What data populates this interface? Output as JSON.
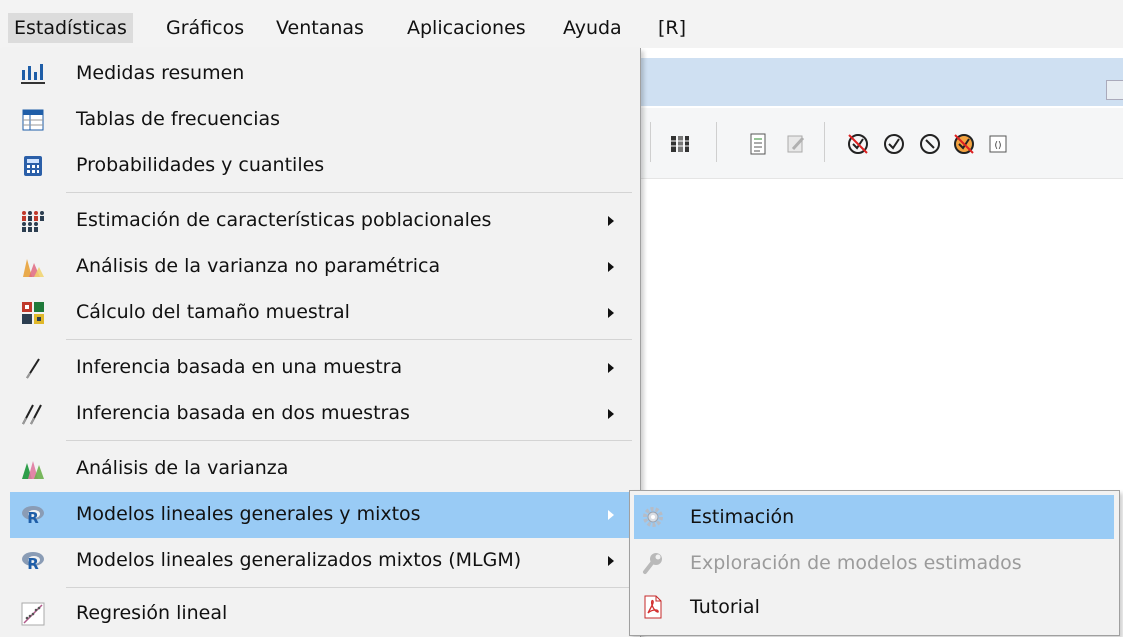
{
  "menubar": {
    "items": [
      "Estadísticas",
      "Gráficos",
      "Ventanas",
      "Aplicaciones",
      "Ayuda",
      "[R]"
    ],
    "active": "Estadísticas"
  },
  "menu": {
    "items": [
      {
        "label": "Medidas resumen",
        "icon": "summary-measures-icon"
      },
      {
        "label": "Tablas de frecuencias",
        "icon": "frequency-table-icon"
      },
      {
        "label": "Probabilidades y cuantiles",
        "icon": "calculator-icon"
      },
      {
        "label": "Estimación de características poblacionales",
        "icon": "population-icon",
        "submenu": true
      },
      {
        "label": "Análisis de la varianza no paramétrica",
        "icon": "nonparametric-anova-icon",
        "submenu": true
      },
      {
        "label": "Cálculo del tamaño muestral",
        "icon": "sample-size-icon",
        "submenu": true
      },
      {
        "label": "Inferencia basada en una muestra",
        "icon": "one-sample-icon",
        "submenu": true
      },
      {
        "label": "Inferencia basada en dos muestras",
        "icon": "two-samples-icon",
        "submenu": true
      },
      {
        "label": "Análisis de la varianza",
        "icon": "anova-icon"
      },
      {
        "label": "Modelos lineales generales y mixtos",
        "icon": "r-logo-icon",
        "submenu": true,
        "highlighted": true
      },
      {
        "label": "Modelos lineales generalizados mixtos (MLGM)",
        "icon": "r-logo-icon",
        "submenu": true
      },
      {
        "label": "Regresión lineal",
        "icon": "scatter-plot-icon"
      }
    ]
  },
  "submenu": {
    "items": [
      {
        "label": "Estimación",
        "icon": "gear-icon",
        "highlighted": true
      },
      {
        "label": "Exploración de modelos estimados",
        "icon": "wrench-icon",
        "disabled": true
      },
      {
        "label": "Tutorial",
        "icon": "pdf-icon"
      }
    ]
  },
  "colors": {
    "highlight": "#99cbf5",
    "menu_background": "#f2f2f2",
    "disabled_text": "#9b9b9b",
    "accent_blue": "#2a63c8"
  }
}
